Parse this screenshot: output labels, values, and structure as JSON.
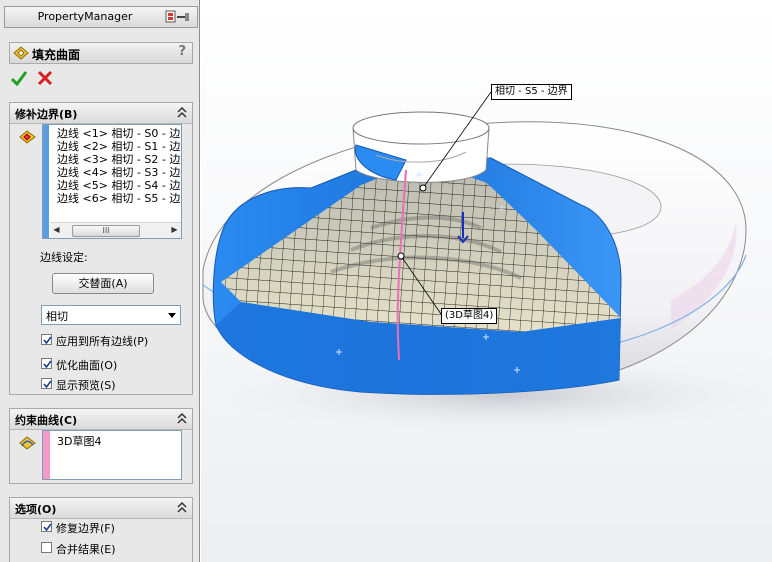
{
  "panel": {
    "title": "PropertyManager",
    "feature_title": "填充曲面",
    "help_glyph": "?",
    "ok_icon": "green-check",
    "cancel_icon": "red-x"
  },
  "patch_boundary": {
    "title": "修补边界(B)",
    "edges": [
      "边线 <1> 相切 - S0 - 边",
      "边线 <2> 相切 - S1 - 边",
      "边线 <3> 相切 - S2 - 边",
      "边线 <4> 相切 - S3 - 边",
      "边线 <5> 相切 - S4 - 边",
      "边线 <6> 相切 - S5 - 边"
    ],
    "scroll_thumb": "III",
    "edge_settings_label": "边线设定:",
    "alternate_face_button": "交替面(A)",
    "condition_value": "相切",
    "apply_all_edges": {
      "label": "应用到所有边线(P)",
      "checked": true
    },
    "optimize_surface": {
      "label": "优化曲面(O)",
      "checked": true
    },
    "show_preview": {
      "label": "显示预览(S)",
      "checked": true
    }
  },
  "constraint_curves": {
    "title": "约束曲线(C)",
    "items": [
      "3D草图4"
    ]
  },
  "options": {
    "title": "选项(O)",
    "fix_boundary": {
      "label": "修复边界(F)",
      "checked": true
    },
    "merge_result": {
      "label": "合并结果(E)",
      "checked": false
    }
  },
  "viewport": {
    "edge_callout": "相切 - S5 - 边界",
    "sketch_callout": "(3D草图4)",
    "colors": {
      "selection_blue": "#1f7fe0",
      "torus_white": "#ffffff",
      "preview_mesh": "#1a1a1a",
      "constraint_curve": "#e86fb8"
    }
  }
}
